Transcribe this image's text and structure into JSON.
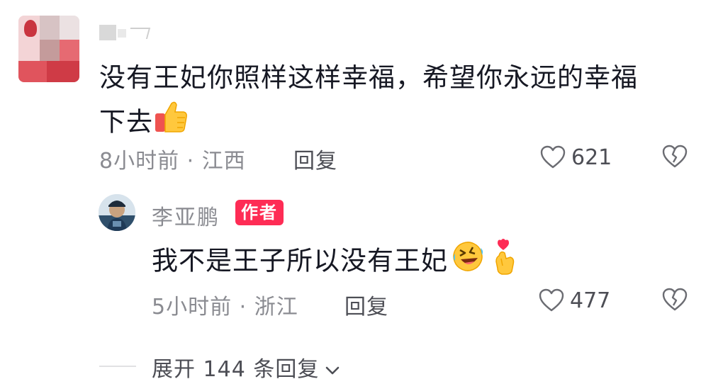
{
  "comment": {
    "username": "",
    "text_line1": "没有王妃你照样这样幸福，希望你永远的幸福",
    "text_line2": "下去",
    "emoji": "thumbs-up-icon",
    "time": "8小时前",
    "location": "江西",
    "separator": "·",
    "reply_label": "回复",
    "likes": "621"
  },
  "reply": {
    "username": "李亚鹏",
    "badge": "作者",
    "text": "我不是王子所以没有王妃",
    "emojis": [
      "rolling-laughing-icon",
      "finger-heart-icon"
    ],
    "time": "5小时前",
    "location": "浙江",
    "separator": "·",
    "reply_label": "回复",
    "likes": "477"
  },
  "expand": {
    "label": "展开 144 条回复"
  },
  "colors": {
    "text_primary": "#161823",
    "text_secondary": "#8a8b91",
    "badge_bg": "#fe2c55"
  }
}
